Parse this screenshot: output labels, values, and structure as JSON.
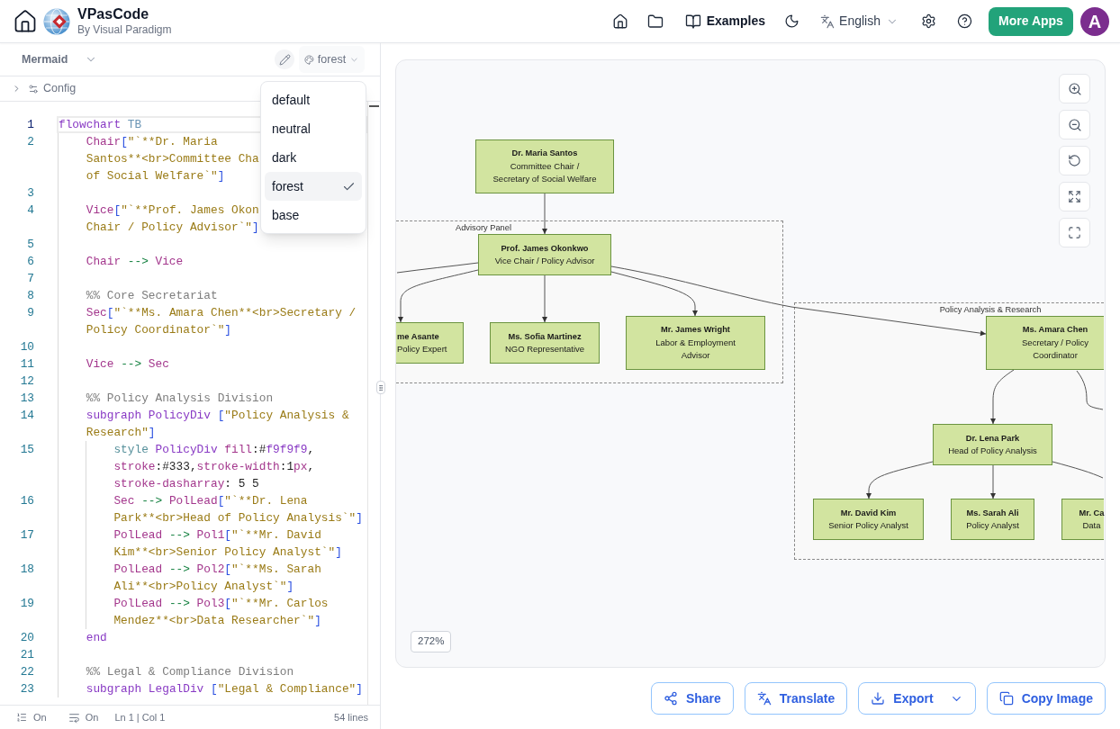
{
  "top_bar": {
    "title": "VPasCode",
    "subtitle": "By Visual Paradigm",
    "examples": "Examples",
    "language": "English",
    "more_apps": "More Apps",
    "avatar": "A"
  },
  "editor_panel": {
    "language": "Mermaid",
    "theme_select": {
      "value": "forest",
      "open": true
    },
    "theme_options": [
      {
        "label": "default",
        "selected": false
      },
      {
        "label": "neutral",
        "selected": false
      },
      {
        "label": "dark",
        "selected": false
      },
      {
        "label": "forest",
        "selected": true
      },
      {
        "label": "base",
        "selected": false
      }
    ],
    "config": {
      "label": "Config",
      "expanded": false
    },
    "code": [
      {
        "number": "1",
        "active": true,
        "wrapped": [
          {
            "tokens": [
              {
                "text": "flowchart ",
                "kind": "keyword"
              },
              {
                "text": "TB",
                "kind": "direction"
              }
            ]
          }
        ],
        "children": [
          {
            "number": "2",
            "active": false,
            "wrapped": [
              {
                "tokens": [
                  {
                    "text": "Chair",
                    "kind": "id"
                  },
                  {
                    "text": "[",
                    "kind": "bracket"
                  },
                  {
                    "text": "\"`**Dr. Maria",
                    "kind": "string"
                  }
                ]
              },
              {
                "tokens": [
                  {
                    "text": "Santos**<br>Committee Cha",
                    "kind": "string"
                  }
                ]
              },
              {
                "tokens": [
                  {
                    "text": "of Social Welfare`\"",
                    "kind": "string"
                  },
                  {
                    "text": "]",
                    "kind": "bracket"
                  }
                ]
              }
            ]
          },
          {
            "number": "3",
            "active": false
          },
          {
            "number": "4",
            "active": false,
            "wrapped": [
              {
                "tokens": [
                  {
                    "text": "Vice",
                    "kind": "id"
                  },
                  {
                    "text": "[",
                    "kind": "bracket"
                  },
                  {
                    "text": "\"`**Prof. James Okon",
                    "kind": "string"
                  }
                ]
              },
              {
                "tokens": [
                  {
                    "text": "Chair / Policy Advisor`\"",
                    "kind": "string"
                  },
                  {
                    "text": "]",
                    "kind": "bracket"
                  }
                ]
              }
            ]
          },
          {
            "number": "5",
            "active": false
          },
          {
            "number": "6",
            "active": false,
            "wrapped": [
              {
                "tokens": [
                  {
                    "text": "Chair ",
                    "kind": "id"
                  },
                  {
                    "text": "--> ",
                    "kind": "arrow"
                  },
                  {
                    "text": "Vice",
                    "kind": "id"
                  }
                ]
              }
            ]
          },
          {
            "number": "7",
            "active": false
          },
          {
            "number": "8",
            "active": false,
            "wrapped": [
              {
                "tokens": [
                  {
                    "text": "%% Core Secretariat",
                    "kind": "comment"
                  }
                ]
              }
            ]
          },
          {
            "number": "9",
            "active": false,
            "wrapped": [
              {
                "tokens": [
                  {
                    "text": "Sec",
                    "kind": "id"
                  },
                  {
                    "text": "[",
                    "kind": "bracket"
                  },
                  {
                    "text": "\"`**Ms. Amara Chen",
                    "kind": "string"
                  },
                  {
                    "text": "**<br>Secretary /",
                    "kind": "string"
                  }
                ]
              },
              {
                "tokens": [
                  {
                    "text": "Policy Coordinator`\"",
                    "kind": "string"
                  },
                  {
                    "text": "]",
                    "kind": "bracket"
                  }
                ]
              }
            ]
          },
          {
            "number": "10",
            "active": false
          },
          {
            "number": "11",
            "active": false,
            "wrapped": [
              {
                "tokens": [
                  {
                    "text": "Vice ",
                    "kind": "id"
                  },
                  {
                    "text": "--> ",
                    "kind": "arrow"
                  },
                  {
                    "text": "Sec",
                    "kind": "id"
                  }
                ]
              }
            ]
          },
          {
            "number": "12",
            "active": false
          },
          {
            "number": "13",
            "active": false,
            "wrapped": [
              {
                "tokens": [
                  {
                    "text": "%% Policy Analysis Division",
                    "kind": "comment"
                  }
                ]
              }
            ]
          },
          {
            "number": "14",
            "active": false,
            "wrapped": [
              {
                "tokens": [
                  {
                    "text": "subgraph ",
                    "kind": "keyword"
                  },
                  {
                    "text": "PolicyDiv ",
                    "kind": "group"
                  },
                  {
                    "text": "[",
                    "kind": "bracket"
                  },
                  {
                    "text": "\"Policy Analysis &",
                    "kind": "string"
                  }
                ]
              },
              {
                "tokens": [
                  {
                    "text": "Research\"",
                    "kind": "string"
                  },
                  {
                    "text": "]",
                    "kind": "bracket"
                  }
                ]
              }
            ],
            "children": [
              {
                "number": "15",
                "active": false,
                "wrapped": [
                  {
                    "tokens": [
                      {
                        "text": "style ",
                        "kind": "style"
                      },
                      {
                        "text": "PolicyDiv ",
                        "kind": "group"
                      },
                      {
                        "text": "fill",
                        "kind": "prop"
                      },
                      {
                        "text": ":#",
                        "kind": "plain"
                      },
                      {
                        "text": "f9f9f9",
                        "kind": "group"
                      },
                      {
                        "text": ",",
                        "kind": "plain"
                      }
                    ]
                  },
                  {
                    "tokens": [
                      {
                        "text": "stroke",
                        "kind": "prop"
                      },
                      {
                        "text": ":#333,",
                        "kind": "plain"
                      },
                      {
                        "text": "stroke-width",
                        "kind": "prop"
                      },
                      {
                        "text": ":1",
                        "kind": "plain"
                      },
                      {
                        "text": "px",
                        "kind": "prop"
                      },
                      {
                        "text": ",",
                        "kind": "plain"
                      }
                    ]
                  },
                  {
                    "tokens": [
                      {
                        "text": "stroke-dasharray",
                        "kind": "prop"
                      },
                      {
                        "text": ": 5 5",
                        "kind": "plain"
                      }
                    ]
                  }
                ]
              },
              {
                "number": "16",
                "active": false,
                "wrapped": [
                  {
                    "tokens": [
                      {
                        "text": "Sec ",
                        "kind": "id"
                      },
                      {
                        "text": "--> ",
                        "kind": "arrow"
                      },
                      {
                        "text": "PolLead",
                        "kind": "id"
                      },
                      {
                        "text": "[",
                        "kind": "bracket"
                      },
                      {
                        "text": "\"`**Dr. Lena",
                        "kind": "string"
                      }
                    ]
                  },
                  {
                    "tokens": [
                      {
                        "text": "Park**<br>Head of Policy Analysis`\"",
                        "kind": "string"
                      },
                      {
                        "text": "]",
                        "kind": "bracket"
                      }
                    ]
                  }
                ]
              },
              {
                "number": "17",
                "active": false,
                "wrapped": [
                  {
                    "tokens": [
                      {
                        "text": "PolLead ",
                        "kind": "id"
                      },
                      {
                        "text": "--> ",
                        "kind": "arrow"
                      },
                      {
                        "text": "Pol1",
                        "kind": "id"
                      },
                      {
                        "text": "[",
                        "kind": "bracket"
                      },
                      {
                        "text": "\"`**Mr. David",
                        "kind": "string"
                      }
                    ]
                  },
                  {
                    "tokens": [
                      {
                        "text": "Kim**<br>Senior Policy Analyst`\"",
                        "kind": "string"
                      },
                      {
                        "text": "]",
                        "kind": "bracket"
                      }
                    ]
                  }
                ]
              },
              {
                "number": "18",
                "active": false,
                "wrapped": [
                  {
                    "tokens": [
                      {
                        "text": "PolLead ",
                        "kind": "id"
                      },
                      {
                        "text": "--> ",
                        "kind": "arrow"
                      },
                      {
                        "text": "Pol2",
                        "kind": "id"
                      },
                      {
                        "text": "[",
                        "kind": "bracket"
                      },
                      {
                        "text": "\"`**Ms. Sarah",
                        "kind": "string"
                      }
                    ]
                  },
                  {
                    "tokens": [
                      {
                        "text": "Ali**<br>Policy Analyst`\"",
                        "kind": "string"
                      },
                      {
                        "text": "]",
                        "kind": "bracket"
                      }
                    ]
                  }
                ]
              },
              {
                "number": "19",
                "active": false,
                "wrapped": [
                  {
                    "tokens": [
                      {
                        "text": "PolLead ",
                        "kind": "id"
                      },
                      {
                        "text": "--> ",
                        "kind": "arrow"
                      },
                      {
                        "text": "Pol3",
                        "kind": "id"
                      },
                      {
                        "text": "[",
                        "kind": "bracket"
                      },
                      {
                        "text": "\"`**Mr. Carlos",
                        "kind": "string"
                      }
                    ]
                  },
                  {
                    "tokens": [
                      {
                        "text": "Mendez**<br>Data Researcher`\"",
                        "kind": "string"
                      },
                      {
                        "text": "]",
                        "kind": "bracket"
                      }
                    ]
                  }
                ]
              }
            ]
          },
          {
            "number": "20",
            "active": false,
            "wrapped": [
              {
                "tokens": [
                  {
                    "text": "end",
                    "kind": "keyword"
                  }
                ]
              }
            ]
          },
          {
            "number": "21",
            "active": false
          },
          {
            "number": "22",
            "active": false,
            "wrapped": [
              {
                "tokens": [
                  {
                    "text": "%% Legal & Compliance Division",
                    "kind": "comment"
                  }
                ]
              }
            ]
          },
          {
            "number": "23",
            "active": false,
            "wrapped": [
              {
                "tokens": [
                  {
                    "text": "subgraph ",
                    "kind": "keyword"
                  },
                  {
                    "text": "LegalDiv ",
                    "kind": "group"
                  },
                  {
                    "text": "[",
                    "kind": "bracket"
                  },
                  {
                    "text": "\"Legal & Compliance\"",
                    "kind": "string"
                  },
                  {
                    "text": "]",
                    "kind": "bracket"
                  }
                ]
              }
            ]
          }
        ]
      }
    ],
    "status_bar": {
      "line_numbers": "On",
      "word_wrap": "On",
      "cursor": "Ln 1 | Col 1",
      "line_count": "54 lines"
    }
  },
  "preview": {
    "groups": [
      {
        "label": "Advisory Panel"
      },
      {
        "label": "Policy Analysis & Research"
      }
    ],
    "org_chart": [
      {
        "title": "Dr. Maria Santos",
        "lines": [
          "Committee Chair /",
          "Secretary of Social Welfare"
        ],
        "children": [
          {
            "title": "Prof. James Okonkwo",
            "lines": [
              "Vice Chair / Policy Advisor"
            ],
            "children": [
              {
                "title": "me Asante",
                "lines": [
                  "Policy Expert"
                ]
              },
              {
                "title": "Ms. Sofia Martinez",
                "lines": [
                  "NGO Representative"
                ]
              },
              {
                "title": "Mr. James Wright",
                "lines": [
                  "Labor & Employment",
                  "Advisor"
                ]
              },
              {
                "title": "Ms. Amara Chen",
                "lines": [
                  "Secretary / Policy",
                  "Coordinator"
                ],
                "children": [
                  {
                    "title": "Dr. Lena Park",
                    "lines": [
                      "Head of Policy Analysis"
                    ],
                    "children": [
                      {
                        "title": "Mr. David Kim",
                        "lines": [
                          "Senior Policy Analyst"
                        ]
                      },
                      {
                        "title": "Ms. Sarah Ali",
                        "lines": [
                          "Policy Analyst"
                        ]
                      },
                      {
                        "title": "Mr. Ca",
                        "lines": [
                          "Data"
                        ]
                      }
                    ]
                  }
                ]
              }
            ]
          }
        ]
      }
    ],
    "zoom": "272%",
    "actions": [
      {
        "label": "Share",
        "kind": "share"
      },
      {
        "label": "Translate",
        "kind": "translate"
      },
      {
        "label": "Export",
        "kind": "export"
      },
      {
        "label": "Copy Image",
        "kind": "copy"
      }
    ]
  }
}
